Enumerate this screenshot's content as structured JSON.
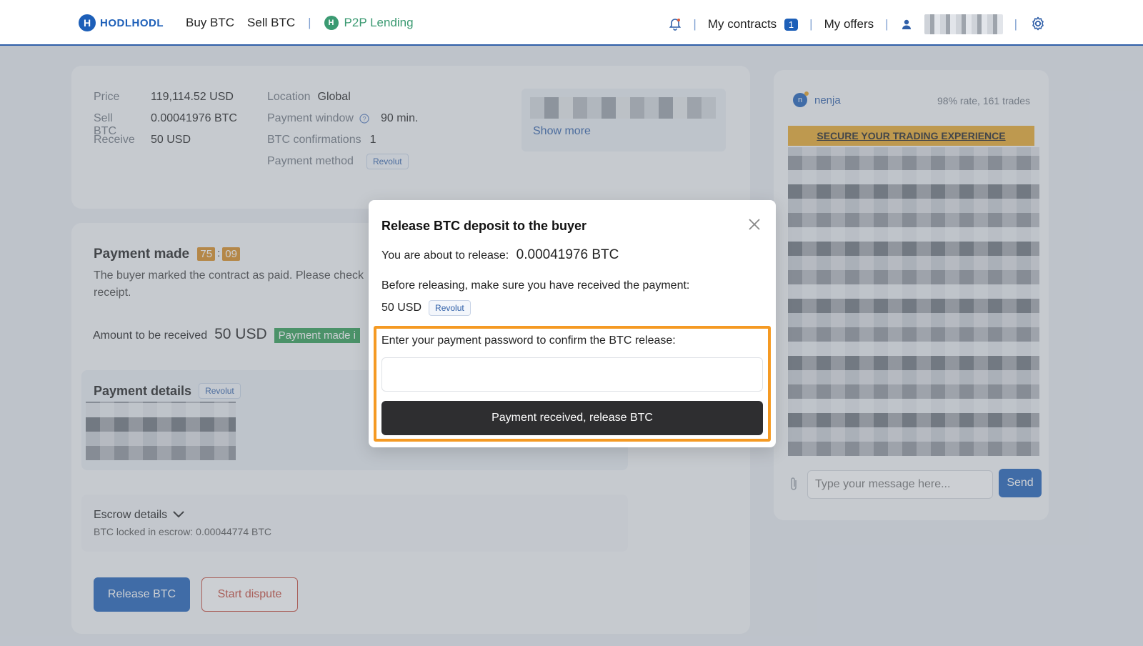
{
  "brand": {
    "name": "HODLHODL",
    "mark": "H"
  },
  "nav": {
    "buy": "Buy BTC",
    "sell": "Sell BTC",
    "separator": "|",
    "p2p_mark": "H",
    "p2p": "P2P Lending",
    "my_contracts": "My contracts",
    "contracts_count": "1",
    "my_offers": "My offers"
  },
  "offer": {
    "price_label": "Price",
    "price_value": "119,114.52 USD",
    "sell_label": "Sell BTC",
    "sell_value": "0.00041976 BTC",
    "receive_label": "Receive",
    "receive_value": "50 USD",
    "location_label": "Location",
    "location_value": "Global",
    "window_label": "Payment window",
    "window_value": "90 min.",
    "confirmations_label": "BTC confirmations",
    "confirmations_value": "1",
    "method_label": "Payment method",
    "method_value": "Revolut",
    "show_more": "Show more"
  },
  "payment": {
    "title": "Payment made",
    "timer_min": "75",
    "timer_sep": ":",
    "timer_sec": "09",
    "desc_line1": "The buyer marked the contract as paid. Please check",
    "desc_line2": "receipt.",
    "amount_label": "Amount to be received",
    "amount_value": "50 USD",
    "status_badge": "Payment made i",
    "details_title": "Payment details",
    "details_method": "Revolut",
    "escrow_title": "Escrow details",
    "escrow_line": "BTC locked in escrow: 0.00044774 BTC",
    "release_button": "Release BTC",
    "dispute_button": "Start dispute"
  },
  "chat": {
    "avatar_letter": "n",
    "user": "nenja",
    "rate": "98% rate, 161 trades",
    "banner": "SECURE YOUR TRADING EXPERIENCE",
    "placeholder": "Type your message here...",
    "send": "Send"
  },
  "modal": {
    "title": "Release BTC deposit to the buyer",
    "about_label": "You are about to release:",
    "about_value": "0.00041976 BTC",
    "before_text": "Before releasing, make sure you have received the payment:",
    "amount": "50 USD",
    "method": "Revolut",
    "pw_prompt": "Enter your payment password to confirm the BTC release:",
    "confirm_button": "Payment received, release BTC"
  },
  "colors": {
    "brand_blue": "#1d5fb8",
    "highlight_orange": "#f59a23",
    "confirm_dark": "#2e2e30",
    "timer_orange": "#d98b1f",
    "status_green": "#2f9d55"
  }
}
